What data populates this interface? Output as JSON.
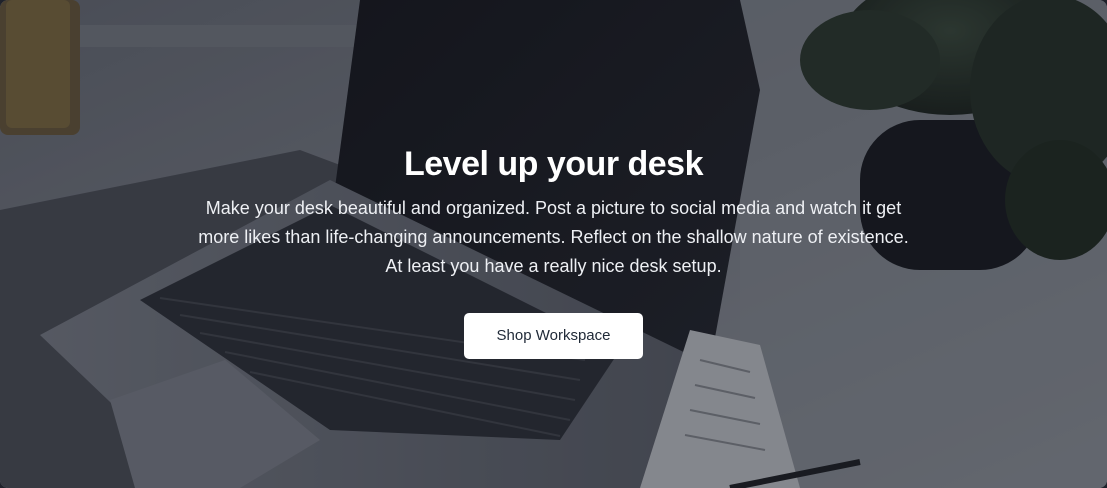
{
  "hero": {
    "title": "Level up your desk",
    "description": "Make your desk beautiful and organized. Post a picture to social media and watch it get more likes than life-changing announcements. Reflect on the shallow nature of existence. At least you have a really nice desk setup.",
    "cta_label": "Shop Workspace"
  },
  "colors": {
    "overlay": "#161820",
    "button_bg": "#ffffff",
    "button_text": "#1f2937",
    "text": "#ffffff"
  }
}
